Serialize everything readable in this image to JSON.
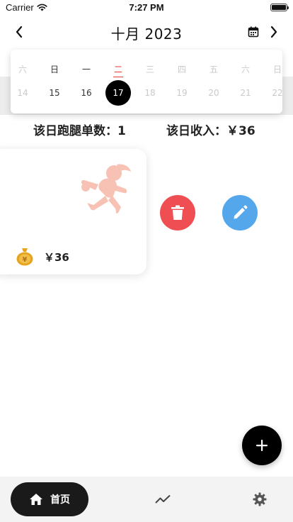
{
  "status_bar": {
    "carrier": "Carrier",
    "time": "7:27 PM",
    "battery_level": 1.0
  },
  "header": {
    "title": "十月 2023"
  },
  "week": {
    "days": [
      {
        "label": "六",
        "date": "14",
        "state": "inactive"
      },
      {
        "label": "日",
        "date": "15",
        "state": "active"
      },
      {
        "label": "一",
        "date": "16",
        "state": "active"
      },
      {
        "label": "二",
        "date": "17",
        "state": "selected"
      },
      {
        "label": "三",
        "date": "18",
        "state": "inactive"
      },
      {
        "label": "四",
        "date": "19",
        "state": "inactive"
      },
      {
        "label": "五",
        "date": "20",
        "state": "inactive"
      },
      {
        "label": "六",
        "date": "21",
        "state": "inactive"
      },
      {
        "label": "日",
        "date": "22",
        "state": "inactive"
      }
    ]
  },
  "stats": {
    "orders_label": "该日跑腿单数：1",
    "income_label": "该日收入：￥36"
  },
  "order": {
    "amount": "￥36"
  },
  "bottom_nav": {
    "home_label": "首页"
  },
  "colors": {
    "selected_bg": "#000000",
    "today_label": "#e53935",
    "delete": "#ef4f52",
    "edit": "#54a7ea",
    "runner": "#f7c1b4",
    "coin": "#e6a521"
  },
  "icons": {
    "back": "chevron-left-icon",
    "forward": "chevron-right-icon",
    "calendar": "calendar-icon",
    "runner": "runner-icon",
    "coin": "money-bag-icon",
    "delete": "trash-icon",
    "edit": "pencil-icon",
    "add": "plus-icon",
    "home": "home-icon",
    "stats": "trend-line-icon",
    "settings": "gear-icon"
  }
}
